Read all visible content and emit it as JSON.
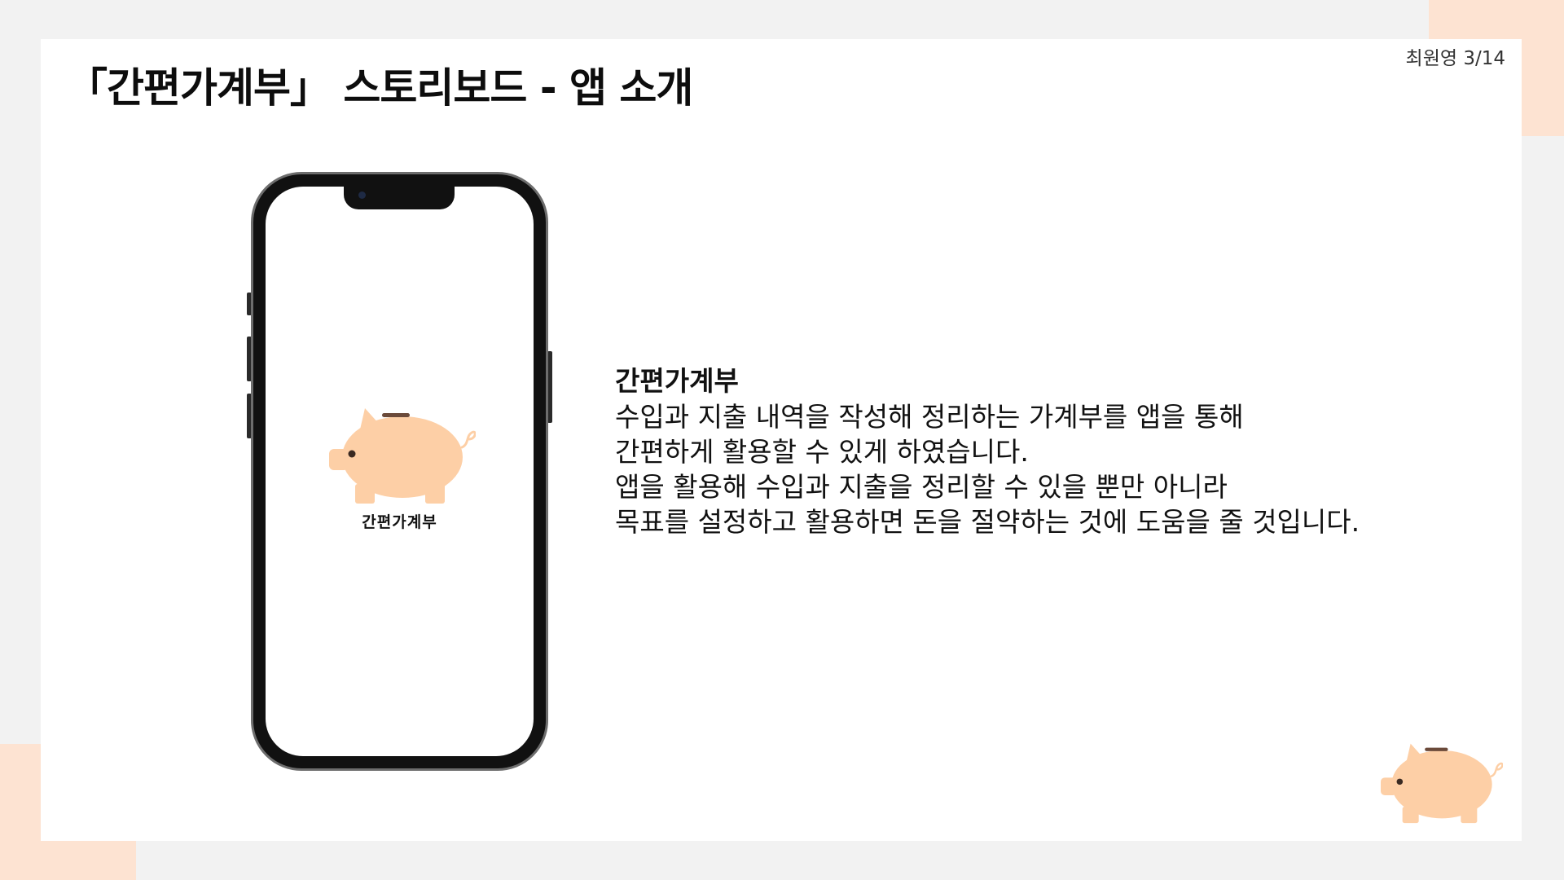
{
  "slide": {
    "title": "「간편가계부」 스토리보드 - 앱 소개",
    "page_info": "최원영 3/14"
  },
  "phone": {
    "app_name": "간편가계부",
    "logo_icon": "piggy-bank-icon"
  },
  "description": {
    "title": "간편가계부",
    "lines": [
      "수입과 지출 내역을 작성해 정리하는 가계부를 앱을 통해",
      "간편하게 활용할 수 있게  하였습니다.",
      "앱을 활용해 수입과 지출을 정리할 수 있을 뿐만 아니라",
      "목표를 설정하고 활용하면 돈을 절약하는 것에 도움을 줄 것입니다."
    ]
  },
  "colors": {
    "accent": "#fde3d2",
    "pig": "#fdcfa6",
    "pig_slot": "#6b4a3a"
  }
}
